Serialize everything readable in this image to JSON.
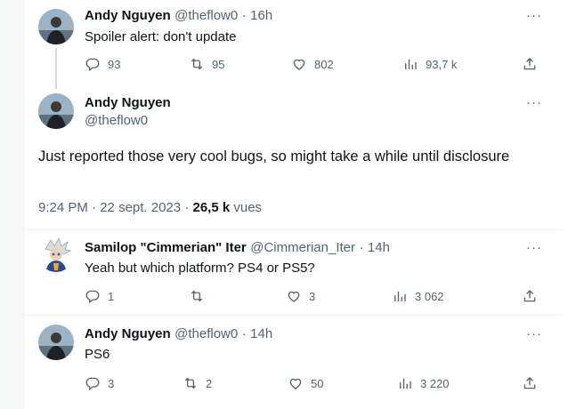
{
  "tweet1": {
    "name": "Andy Nguyen",
    "handle": "@theflow0",
    "time": "16h",
    "text": "Spoiler alert: don't update",
    "replies": "93",
    "retweets": "95",
    "likes": "802",
    "views": "93,7 k"
  },
  "main": {
    "name": "Andy Nguyen",
    "handle": "@theflow0",
    "text": "Just reported those very cool bugs, so might take a while until disclosure",
    "time": "9:24 PM",
    "date": "22 sept. 2023",
    "views_count": "26,5 k",
    "views_label": "vues"
  },
  "reply1": {
    "name": "Samilop \"Cimmerian\" Iter",
    "handle": "@Cimmerian_Iter",
    "time": "14h",
    "text": "Yeah but which platform? PS4 or PS5?",
    "replies": "1",
    "retweets": "",
    "likes": "3",
    "views": "3 062"
  },
  "reply2": {
    "name": "Andy Nguyen",
    "handle": "@theflow0",
    "time": "14h",
    "text": "PS6",
    "replies": "3",
    "retweets": "2",
    "likes": "50",
    "views": "3 220"
  },
  "separator": "·",
  "more": "···",
  "icons": {
    "reply": "reply-icon",
    "retweet": "retweet-icon",
    "like": "like-icon",
    "views": "views-icon",
    "share": "share-icon",
    "more": "more-icon"
  },
  "colors": {
    "text": "#0f1419",
    "secondary": "#536471",
    "border": "#eff3f4",
    "thread": "#cfd9de"
  }
}
